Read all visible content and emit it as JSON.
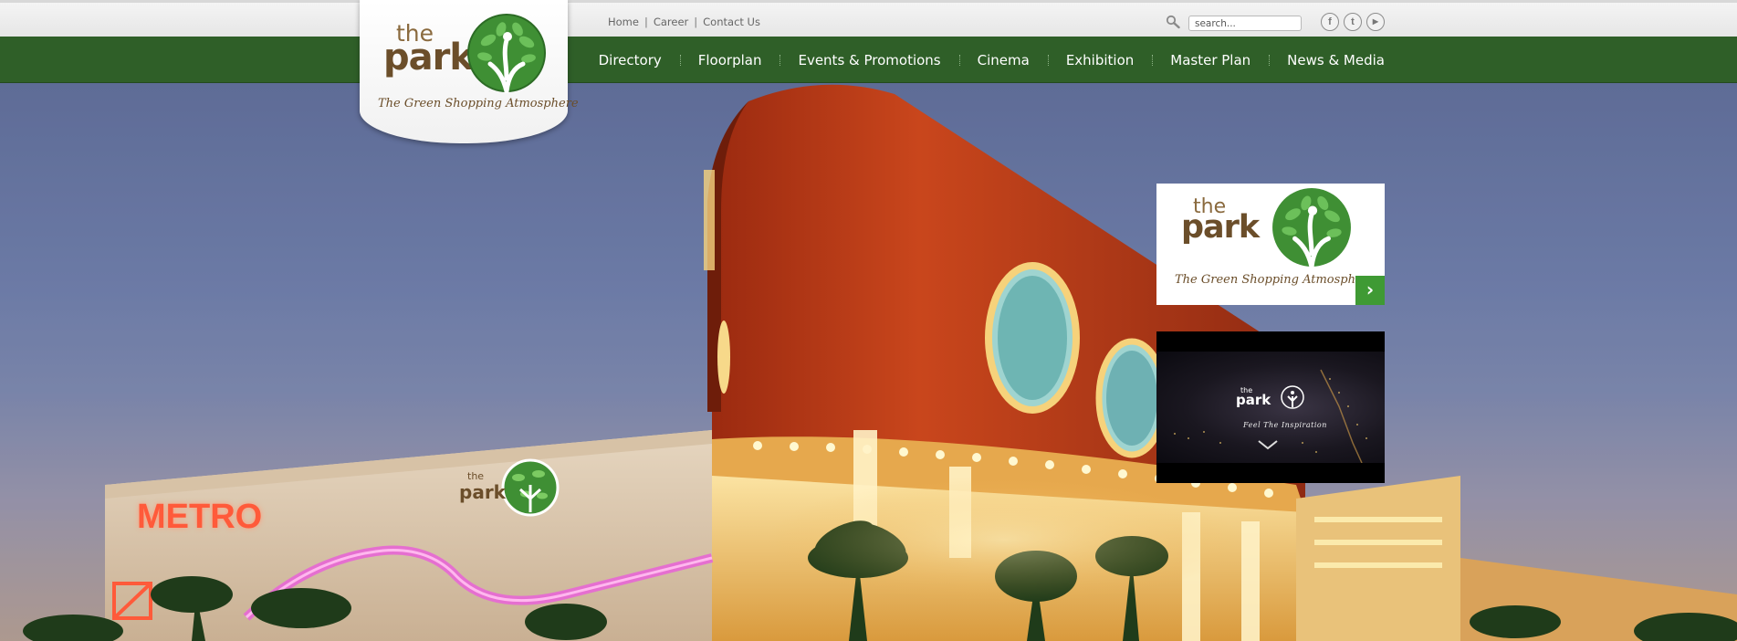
{
  "top_links": {
    "home": "Home",
    "career": "Career",
    "contact": "Contact Us",
    "separator": "|"
  },
  "search": {
    "placeholder": "search..."
  },
  "social": {
    "facebook": "f",
    "twitter": "t",
    "youtube": "▶"
  },
  "nav": {
    "items": [
      {
        "label": "Directory"
      },
      {
        "label": "Floorplan"
      },
      {
        "label": "Events & Promotions"
      },
      {
        "label": "Cinema"
      },
      {
        "label": "Exhibition"
      },
      {
        "label": "Master Plan"
      },
      {
        "label": "News & Media"
      }
    ]
  },
  "logo": {
    "the": "the",
    "park": "park",
    "tagline": "The Green Shopping Atmosphere"
  },
  "hero": {
    "building_logo_the": "the",
    "building_logo_park": "park",
    "metro_sign": "METRO"
  },
  "promo": {
    "the": "the",
    "park": "park",
    "tagline": "The Green Shopping Atmosphere",
    "next_icon": "›"
  },
  "video": {
    "the": "the",
    "park": "park",
    "caption": "Feel The Inspiration"
  },
  "colors": {
    "nav_green": "#2f5f28",
    "brand_brown": "#6b4e2a",
    "leaf_green": "#3f9a34",
    "next_button": "#3f9a34"
  }
}
